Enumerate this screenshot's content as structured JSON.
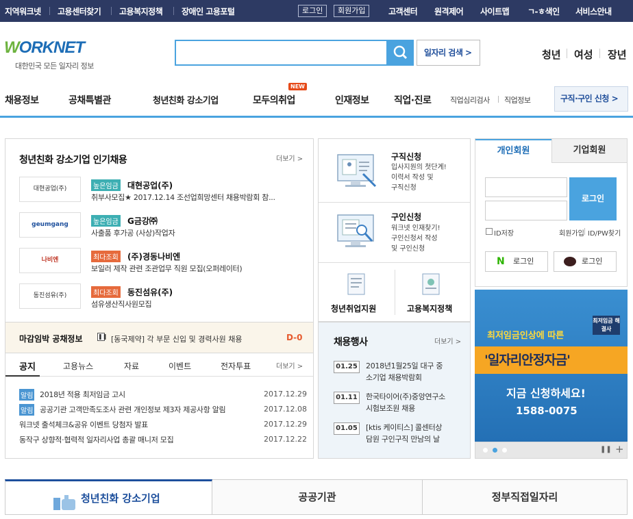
{
  "topbar": {
    "left_links": [
      "지역워크넷",
      "고용센터찾기",
      "고용복지정책",
      "장애인 고용포털"
    ],
    "login": "로그인",
    "join": "회원가입",
    "right_links": [
      "고객센터",
      "원격제어",
      "사이트맵",
      "ㄱ-ㅎ색인",
      "서비스안내"
    ]
  },
  "header": {
    "logo_text": "WORKNET",
    "logo_sub": "대한민국 모든 일자리 정보",
    "search_placeholder": "",
    "job_search_label": "일자리 검색 >",
    "age_nav": [
      "청년",
      "여성",
      "장년"
    ]
  },
  "main_nav": {
    "items": [
      "채용정보",
      "공채특별관",
      "청년친화 강소기업",
      "모두의취업",
      "인재정보",
      "직업·진로"
    ],
    "new_badge": "NEW",
    "sub_items": [
      "직업심리검사",
      "직업정보"
    ],
    "apply_button": "구직·구인 신청 >"
  },
  "popular": {
    "title": "청년친화 강소기업 인기채용",
    "more": "더보기 >",
    "companies": [
      {
        "logo": "대현공업(주)",
        "badge": "높은임금",
        "badge_color": "#3dafb3",
        "name": "대현공업(주)",
        "desc": "취부사모집★ 2017.12.14 조선업희망센터 채용박람회 참..."
      },
      {
        "logo": "geumgang",
        "badge": "높은임금",
        "badge_color": "#3dafb3",
        "name": "G금강㈜",
        "desc": "사출품 후가공 (사상)작업자"
      },
      {
        "logo": "나비엔",
        "badge": "최다조회",
        "badge_color": "#e66a3c",
        "name": "(주)경동나비엔",
        "desc": "보일러 제작 관련 조관업무 직원 모집(오퍼레이터)"
      },
      {
        "logo": "동진섬유(주)",
        "badge": "최다조회",
        "badge_color": "#e66a3c",
        "name": "동진섬유(주)",
        "desc": "섬유생산직사원모집"
      }
    ]
  },
  "deadline": {
    "title": "마감임박 공채정보",
    "text": "[동국제약] 각 부문 신입 및 경력사원 채용",
    "dday": "D-0"
  },
  "notice": {
    "tabs": [
      "공지",
      "고용뉴스",
      "자료",
      "이벤트",
      "전자투표"
    ],
    "more": "더보기 >",
    "items": [
      {
        "tag": "알림",
        "text": "2018년 적용 최저임금 고시",
        "date": "2017.12.29"
      },
      {
        "tag": "알림",
        "text": "공공기관 고객만족도조사 관련 개인정보 제3자 제공사항 알림",
        "date": "2017.12.08"
      },
      {
        "tag": "",
        "text": "워크넷 출석체크&공유 이벤트 당첨자 발표",
        "date": "2017.12.29"
      },
      {
        "tag": "",
        "text": "동작구 상향적·협력적 일자리사업 총괄 매니저 모집",
        "date": "2017.12.22"
      }
    ]
  },
  "services": {
    "job_apply": {
      "title": "구직신청",
      "lines": [
        "입사지원의 첫단계!",
        "이력서 작성 및",
        "구직신청"
      ]
    },
    "hire_apply": {
      "title": "구인신청",
      "lines": [
        "워크넷 인재찾기!",
        "구인신청서 작성",
        "및 구인신청"
      ]
    },
    "youth": "청년취업지원",
    "welfare": "고용복지정책"
  },
  "events": {
    "title": "채용행사",
    "more": "더보기 >",
    "items": [
      {
        "date": "01.25",
        "lines": [
          "2018년1월25일 대구 중",
          "소기업 채용박람회"
        ]
      },
      {
        "date": "01.11",
        "lines": [
          "한국타이어(주)중앙연구소",
          "시험보조원 채용"
        ]
      },
      {
        "date": "01.05",
        "lines": [
          "[ktis 케이티스] 콜센터상",
          "담원 구인구직 만남의 날"
        ]
      }
    ]
  },
  "login_box": {
    "tabs": [
      "개인회원",
      "기업회원"
    ],
    "login_button": "로그인",
    "save_id": "ID저장",
    "join": "회원가입",
    "find": "ID/PW찾기",
    "naver": "로그인",
    "kakao": "로그인"
  },
  "banner": {
    "line1": "최저임금인상에 따른",
    "line2": "'일자리안정자금'",
    "line3": "지금 신청하세요!",
    "line4": "1588-0075",
    "badge": "최저임금 해결사"
  },
  "bottom_tabs": [
    "청년친화 강소기업",
    "공공기관",
    "정부직접일자리"
  ],
  "colors": {
    "primary": "#2d3a63",
    "accent": "#4aa3df",
    "high_wage": "#3dafb3",
    "most_viewed": "#e66a3c"
  }
}
